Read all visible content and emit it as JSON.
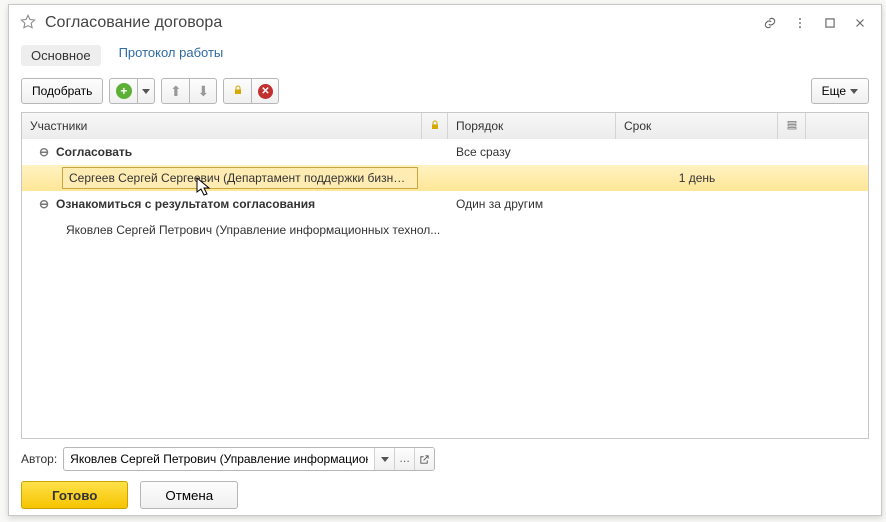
{
  "header": {
    "title": "Согласование договора"
  },
  "tabs": {
    "main": "Основное",
    "protocol": "Протокол работы"
  },
  "toolbar": {
    "pick": "Подобрать",
    "more": "Еще"
  },
  "table": {
    "headers": {
      "participants": "Участники",
      "order": "Порядок",
      "term": "Срок"
    },
    "group1": {
      "name": "Согласовать",
      "order": "Все сразу",
      "child": {
        "name": "Сергеев Сергей Сергеевич (Департамент поддержки бизнеса, Р...",
        "term": "1 день"
      }
    },
    "group2": {
      "name": "Ознакомиться с результатом согласования",
      "order": "Один за другим",
      "child": {
        "name": "Яковлев Сергей Петрович (Управление информационных технол..."
      }
    }
  },
  "footer": {
    "author_label": "Автор:",
    "author_value": "Яковлев Сергей Петрович (Управление информационны)",
    "done": "Готово",
    "cancel": "Отмена"
  }
}
